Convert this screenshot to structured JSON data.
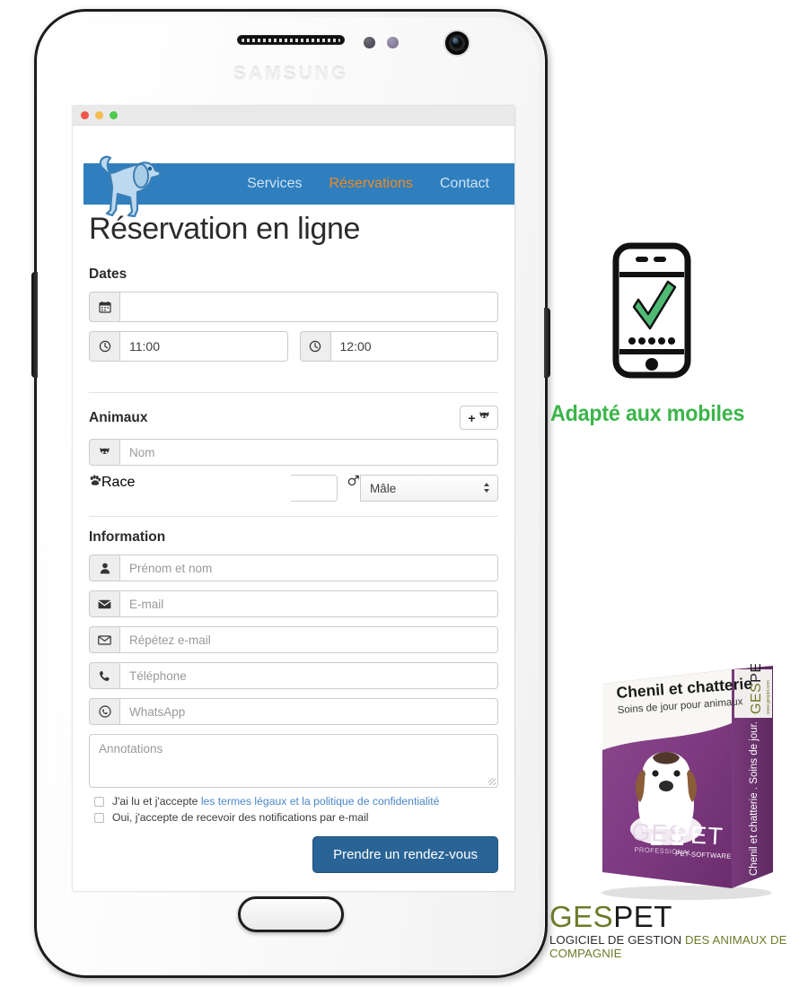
{
  "device": {
    "brand": "SAMSUNG",
    "speaker_icon": "speaker-grille-icon",
    "camera_icon": "front-camera-icon",
    "home_button": "home-button"
  },
  "browser": {
    "dots": [
      "close-dot",
      "minimize-dot",
      "maximize-dot"
    ]
  },
  "site": {
    "logo_alt": "dog-logo",
    "nav": [
      {
        "label": "Services",
        "active": false
      },
      {
        "label": "Réservations",
        "active": true
      },
      {
        "label": "Contact",
        "active": false
      }
    ],
    "title": "Réservation en ligne",
    "sections": {
      "dates": {
        "heading": "Dates",
        "date_field": {
          "icon": "calendar-icon",
          "value": "",
          "placeholder": ""
        },
        "time_start": {
          "icon": "clock-icon",
          "value": "11:00"
        },
        "time_end": {
          "icon": "clock-icon",
          "value": "12:00"
        }
      },
      "animaux": {
        "heading": "Animaux",
        "add_button": {
          "icon": "add-pet-icon",
          "label": "+"
        },
        "name_field": {
          "icon": "pet-face-icon",
          "placeholder": "Nom"
        },
        "race_field": {
          "icon": "paw-icon",
          "placeholder": "Race"
        },
        "gender_select": {
          "icon": "gender-icon",
          "value": "Mâle",
          "caret": "▲▼"
        }
      },
      "information": {
        "heading": "Information",
        "fields": [
          {
            "icon": "user-icon",
            "placeholder": "Prénom et nom"
          },
          {
            "icon": "mail-filled-icon",
            "placeholder": "E-mail"
          },
          {
            "icon": "mail-outline-icon",
            "placeholder": "Répétez e-mail"
          },
          {
            "icon": "phone-icon",
            "placeholder": "Téléphone"
          },
          {
            "icon": "whatsapp-icon",
            "placeholder": "WhatsApp"
          }
        ],
        "notes_placeholder": "Annotations",
        "consent": {
          "text_before": "J'ai lu et j'accepte ",
          "link_text": "les termes légaux et la politique de confidentialité"
        },
        "newsletter": "Oui, j'accepte de recevoir des notifications par e-mail",
        "submit_label": "Prendre un rendez-vous"
      }
    }
  },
  "promo": {
    "mobile_icon": "mobile-check-icon",
    "adapted_text": "Adapté aux mobiles",
    "adapted_color": "#3cb54a"
  },
  "boxshot": {
    "title": "Chenil et chatterie",
    "subtitle": "Soins de jour pour animaux",
    "logo_ges": "GES",
    "logo_pet": "PET",
    "logo_sub": "PET SOFTWARE",
    "logo_pro": "PROFESSIONAL",
    "spine_text": "Chenil et chatterie . Soins de jour.",
    "spine_logo_ges": "GES",
    "spine_logo_pet": "PET",
    "spine_url": "www.gespet.com",
    "box_color": "#7e3a80"
  },
  "footer_logo": {
    "ges": "GES",
    "pet": "PET",
    "tagline_dark": "LOGICIEL DE GESTION ",
    "tagline_green": "DES ANIMAUX DE COMPAGNIE"
  }
}
